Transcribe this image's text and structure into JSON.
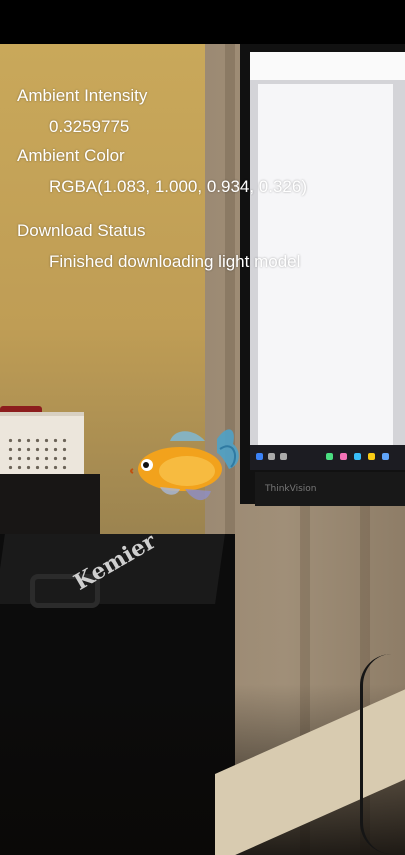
{
  "overlay": {
    "ambient_intensity_label": "Ambient Intensity",
    "ambient_intensity_value": "0.3259775",
    "ambient_color_label": "Ambient Color",
    "ambient_color_value": "RGBA(1.083, 1.000, 0.934, 0.326)",
    "download_status_label": "Download Status",
    "download_status_value": "Finished downloading light model"
  },
  "scene": {
    "monitor_brand": "ThinkVision",
    "box_brand": "Kemier"
  },
  "colors": {
    "overlay_text": "#ffffff",
    "fish_body": "#f2a21c",
    "fish_fin": "#5aa6c8"
  }
}
